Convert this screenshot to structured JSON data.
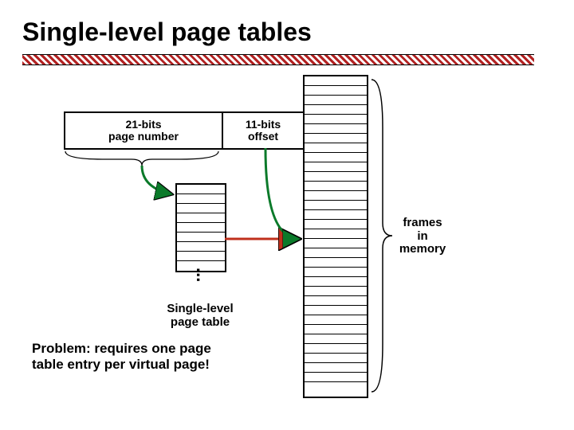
{
  "title": "Single-level page tables",
  "address": {
    "page_bits_label": "21-bits",
    "page_sub_label": "page number",
    "offset_bits_label": "11-bits",
    "offset_sub_label": "offset"
  },
  "page_table_label_line1": "Single-level",
  "page_table_label_line2": "page table",
  "frames_label_line1": "frames",
  "frames_label_line2": "in",
  "frames_label_line3": "memory",
  "ellipsis": "...",
  "problem_line1": "Problem: requires one page",
  "problem_line2": "table entry per virtual page!"
}
